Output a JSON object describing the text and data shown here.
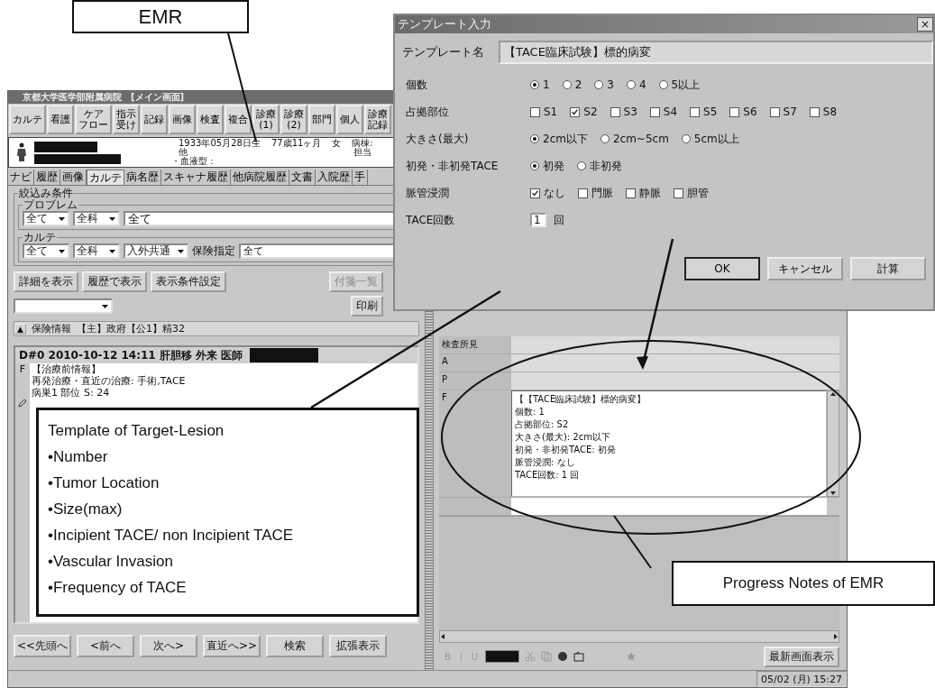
{
  "annotations": {
    "emr_label": "EMR",
    "lesion_callout": {
      "title": "Template of Target-Lesion",
      "items": [
        "•Number",
        "•Tumor Location",
        "•Size(max)",
        "•Incipient TACE/ non Incipient TACE",
        "•Vascular Invasion",
        "•Frequency of TACE"
      ]
    },
    "notes_label": "Progress Notes of EMR"
  },
  "main_window": {
    "title": "京都大学医学部附属病院",
    "subtitle": "[メイン画面]",
    "toolbar": [
      {
        "lines": [
          "カルテ"
        ]
      },
      {
        "lines": [
          "看護"
        ]
      },
      {
        "lines": [
          "ケア",
          "フロー"
        ]
      },
      {
        "lines": [
          "指示",
          "受け"
        ]
      },
      {
        "lines": [
          "記録"
        ]
      },
      {
        "lines": [
          "画像"
        ]
      },
      {
        "lines": [
          "検査"
        ]
      },
      {
        "lines": [
          "複合"
        ]
      },
      {
        "lines": [
          "診療",
          "(1)"
        ]
      },
      {
        "lines": [
          "診療",
          "(2)"
        ]
      },
      {
        "lines": [
          "部門"
        ]
      },
      {
        "lines": [
          "個人"
        ]
      },
      {
        "lines": [
          "診療",
          "記録"
        ]
      }
    ],
    "patient": {
      "birth": "1933年05月28日生",
      "age": "77歳11ヶ月",
      "sex": "女",
      "ward": "病棟:",
      "other": "他",
      "staff": "担当",
      "blood": "・血液型 :"
    },
    "tabs": [
      {
        "label": "ナビ",
        "selected": false
      },
      {
        "label": "履歴",
        "selected": false
      },
      {
        "label": "画像",
        "selected": false
      },
      {
        "label": "カルテ",
        "selected": true
      },
      {
        "label": "病名歴",
        "selected": false
      },
      {
        "label": "スキャナ履歴",
        "selected": false
      },
      {
        "label": "他病院履歴",
        "selected": false
      },
      {
        "label": "文書",
        "selected": false
      },
      {
        "label": "入院歴",
        "selected": false
      },
      {
        "label": "手",
        "selected": false
      }
    ],
    "filter": {
      "legend": "絞込み条件",
      "problem": {
        "legend": "プロブレム",
        "selects": [
          "全て",
          "全科"
        ],
        "field": "全て"
      },
      "karte": {
        "legend": "カルテ",
        "selects": [
          "全て",
          "全科",
          "入外共通"
        ],
        "field_label": "保険指定",
        "field": "全て"
      }
    },
    "view_buttons": [
      {
        "label": "詳細を表示",
        "disabled": false
      },
      {
        "label": "履歴で表示",
        "disabled": false
      },
      {
        "label": "表示条件設定",
        "disabled": false
      },
      {
        "label": "付箋一覧",
        "disabled": true
      }
    ],
    "print_button": "印刷",
    "insurance": {
      "toggle": "▲",
      "label": "保険情報",
      "value": "【主】政府【公1】精32"
    },
    "record": {
      "header": "D#0 2010-10-12 14:11 肝胆移 外来 医師",
      "section": "F",
      "lines": [
        "【治療前情報】",
        "再発治療・直近の治療: 手術,TACE",
        "病巣1 部位 S: 24"
      ]
    },
    "nav_buttons": [
      "<<先頭へ",
      "<前へ",
      "次へ>",
      "直近へ>>",
      "検索",
      "拡張表示"
    ],
    "notes": {
      "rows": [
        {
          "label": "検査所見"
        },
        {
          "label": "A"
        },
        {
          "label": "P"
        },
        {
          "label": "F",
          "lines": [
            "【【TACE臨床試験】標的病変】",
            "個数: 1",
            "占拠部位: S2",
            "大きさ(最大): 2cm以下",
            "初発・非初発TACE: 初発",
            "脈管浸潤: なし",
            "TACE回数: 1 回"
          ]
        }
      ],
      "format_buttons": [
        "B",
        "I",
        "U"
      ],
      "latest_button": "最新画面表示"
    },
    "status_time": "05/02 (月) 15:27"
  },
  "dialog": {
    "title": "テンプレート入力",
    "close": "×",
    "name_label": "テンプレート名",
    "name_value": "【TACE臨床試験】標的病変",
    "fields": [
      {
        "kind": "radio",
        "label": "個数",
        "options": [
          {
            "label": "1",
            "selected": true
          },
          {
            "label": "2",
            "selected": false
          },
          {
            "label": "3",
            "selected": false
          },
          {
            "label": "4",
            "selected": false
          },
          {
            "label": "5以上",
            "selected": false
          }
        ]
      },
      {
        "kind": "checkbox",
        "label": "占拠部位",
        "options": [
          {
            "label": "S1",
            "checked": false
          },
          {
            "label": "S2",
            "checked": true
          },
          {
            "label": "S3",
            "checked": false
          },
          {
            "label": "S4",
            "checked": false
          },
          {
            "label": "S5",
            "checked": false
          },
          {
            "label": "S6",
            "checked": false
          },
          {
            "label": "S7",
            "checked": false
          },
          {
            "label": "S8",
            "checked": false
          }
        ]
      },
      {
        "kind": "radio",
        "label": "大きさ(最大)",
        "options": [
          {
            "label": "2cm以下",
            "selected": true
          },
          {
            "label": "2cm~5cm",
            "selected": false
          },
          {
            "label": "5cm以上",
            "selected": false
          }
        ]
      },
      {
        "kind": "radio",
        "label": "初発・非初発TACE",
        "options": [
          {
            "label": "初発",
            "selected": true
          },
          {
            "label": "非初発",
            "selected": false
          }
        ]
      },
      {
        "kind": "checkbox",
        "label": "脈管浸潤",
        "options": [
          {
            "label": "なし",
            "checked": true
          },
          {
            "label": "門脈",
            "checked": false
          },
          {
            "label": "静脈",
            "checked": false
          },
          {
            "label": "胆管",
            "checked": false
          }
        ]
      },
      {
        "kind": "number",
        "label": "TACE回数",
        "value": "1",
        "unit": "回"
      }
    ],
    "buttons": [
      "OK",
      "キャンセル",
      "計算"
    ]
  }
}
